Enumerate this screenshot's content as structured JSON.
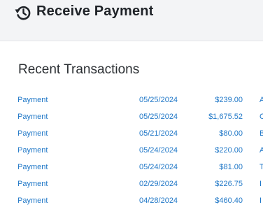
{
  "header": {
    "title": "Receive Payment",
    "icon": "history-icon"
  },
  "recent": {
    "title": "Recent Transactions",
    "rows": [
      {
        "type": "Payment",
        "date": "05/25/2024",
        "amount": "$239.00",
        "extra": "A"
      },
      {
        "type": "Payment",
        "date": "05/25/2024",
        "amount": "$1,675.52",
        "extra": "C"
      },
      {
        "type": "Payment",
        "date": "05/21/2024",
        "amount": "$80.00",
        "extra": "B"
      },
      {
        "type": "Payment",
        "date": "05/24/2024",
        "amount": "$220.00",
        "extra": "A"
      },
      {
        "type": "Payment",
        "date": "05/24/2024",
        "amount": "$81.00",
        "extra": "T"
      },
      {
        "type": "Payment",
        "date": "02/29/2024",
        "amount": "$226.75",
        "extra": "I"
      },
      {
        "type": "Payment",
        "date": "04/28/2024",
        "amount": "$460.40",
        "extra": "I"
      }
    ]
  },
  "colors": {
    "link": "#1f77c7",
    "title": "#1f2328",
    "background": "#f3f4f6",
    "panel": "#ffffff"
  }
}
